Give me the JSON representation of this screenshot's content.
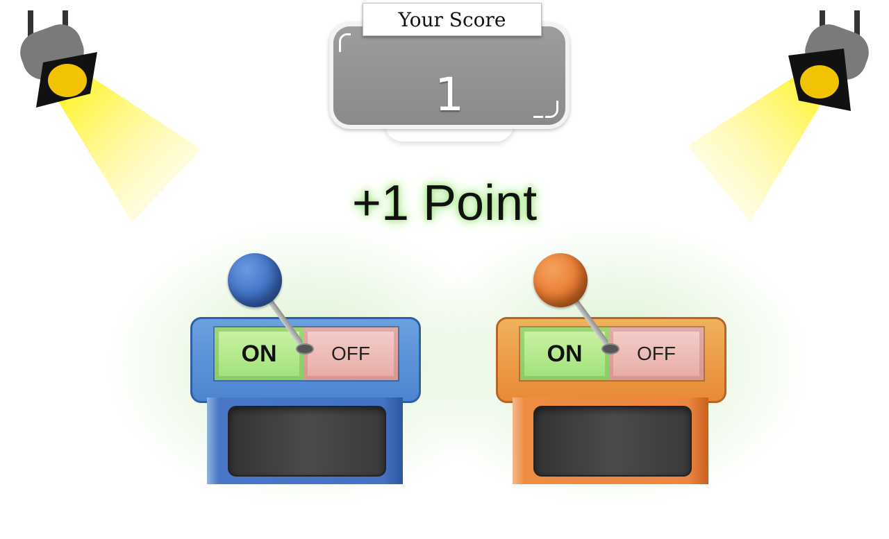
{
  "score": {
    "label": "Your Score",
    "value": "1"
  },
  "feedback": {
    "text": "+1 Point",
    "glow_color": "#9be27a"
  },
  "podiums": [
    {
      "color": "blue",
      "accent": "#4a78c7",
      "on_label": "ON",
      "off_label": "OFF",
      "state": "ON"
    },
    {
      "color": "orange",
      "accent": "#ec8540",
      "on_label": "ON",
      "off_label": "OFF",
      "state": "ON"
    }
  ],
  "spotlights": [
    "spotlight-left",
    "spotlight-right"
  ],
  "colors": {
    "beam": "#ffef3a",
    "score_panel": "#8f8f8f"
  }
}
